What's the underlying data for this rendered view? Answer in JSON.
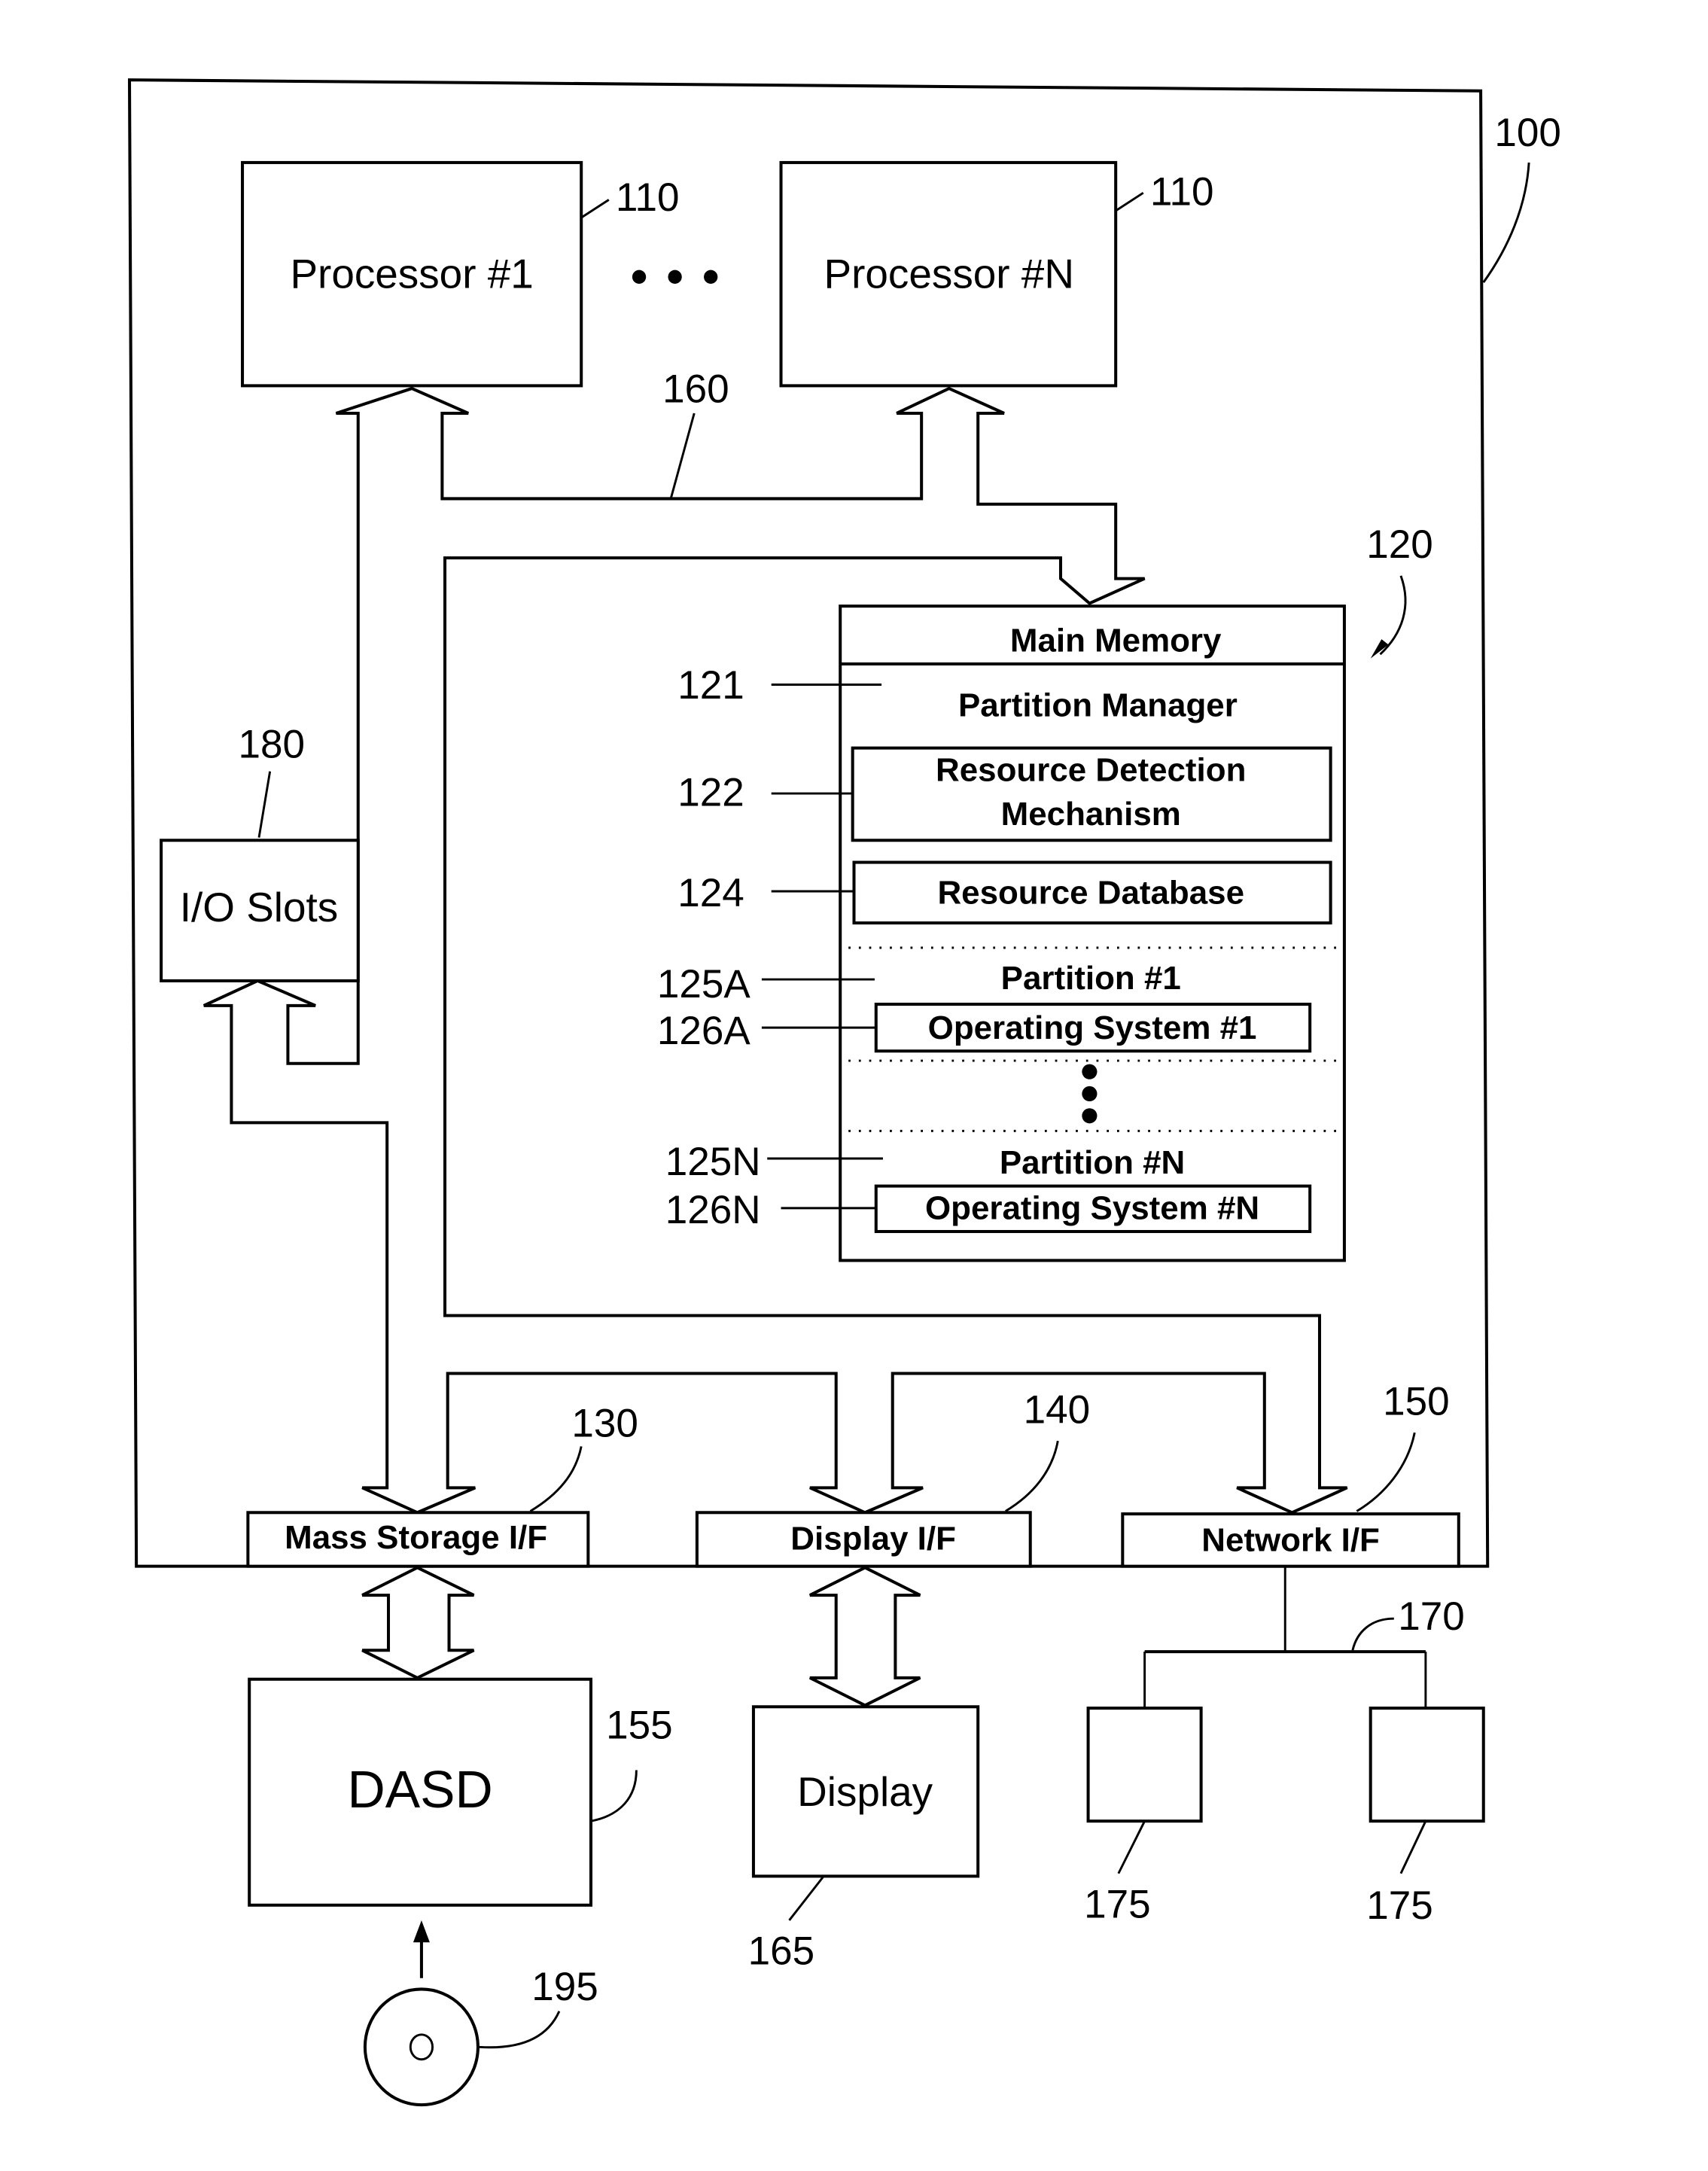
{
  "figure": {
    "system_ref": "100",
    "processors": [
      {
        "label": "Processor #1",
        "ref": "110"
      },
      {
        "label": "Processor #N",
        "ref": "110"
      }
    ],
    "bus_ref": "160",
    "main_memory": {
      "ref": "120",
      "title": "Main Memory",
      "partition_manager": {
        "label": "Partition Manager",
        "ref": "121"
      },
      "resource_detection": {
        "line1": "Resource Detection",
        "line2": "Mechanism",
        "ref": "122"
      },
      "resource_database": {
        "label": "Resource Database",
        "ref": "124"
      },
      "partitions": [
        {
          "label": "Partition #1",
          "ref": "125A",
          "os_label": "Operating System #1",
          "os_ref": "126A"
        },
        {
          "label": "Partition #N",
          "ref": "125N",
          "os_label": "Operating System #N",
          "os_ref": "126N"
        }
      ]
    },
    "io_slots": {
      "label": "I/O Slots",
      "ref": "180"
    },
    "interfaces": [
      {
        "label": "Mass Storage I/F",
        "ref": "130"
      },
      {
        "label": "Display I/F",
        "ref": "140"
      },
      {
        "label": "Network I/F",
        "ref": "150"
      }
    ],
    "dasd": {
      "label": "DASD",
      "ref": "155"
    },
    "display": {
      "label": "Display",
      "ref": "165"
    },
    "network_ref": "170",
    "workstations": [
      {
        "ref": "175"
      },
      {
        "ref": "175"
      }
    ],
    "media_ref": "195"
  }
}
